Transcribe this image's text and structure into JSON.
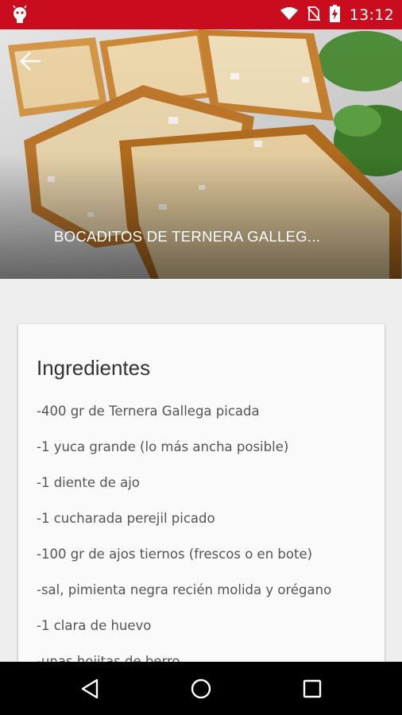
{
  "status_bar": {
    "time": "13:12",
    "icons": [
      "android-debug-icon",
      "wifi-icon",
      "no-sim-icon",
      "battery-charging-icon"
    ],
    "background": "#c90d1e"
  },
  "header": {
    "title": "BOCADITOS DE TERNERA GALLEG...",
    "back_icon": "arrow-back-icon"
  },
  "card": {
    "heading": "Ingredientes",
    "items": [
      "-400 gr de Ternera Gallega picada",
      "-1 yuca grande (lo más ancha posible)",
      "-1 diente de ajo",
      "-1 cucharada perejil picado",
      "-100 gr de ajos tiernos (frescos o en bote)",
      "-sal, pimienta negra recién molida y orégano",
      "-1 clara de huevo",
      "-unas hojitas de berro"
    ]
  },
  "nav_bar": {
    "icons": [
      "back-triangle-icon",
      "home-circle-icon",
      "recents-square-icon"
    ]
  }
}
